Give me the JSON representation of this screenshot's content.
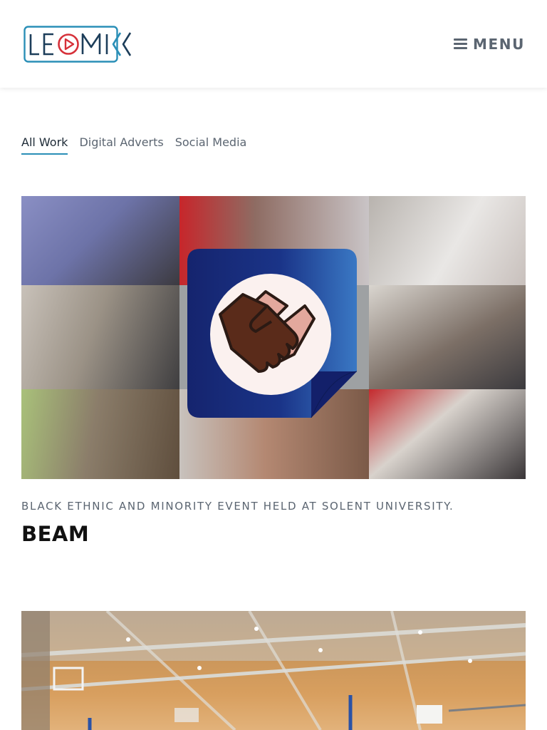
{
  "header": {
    "logo_text": "LEOMIK",
    "menu_label": "MENU",
    "colors": {
      "logo_blue": "#2a8fb7",
      "logo_red": "#d6313a",
      "logo_navy": "#1d3e5a",
      "menu_gray": "#5b6571"
    }
  },
  "filters": [
    {
      "label": "All Work",
      "active": true
    },
    {
      "label": "Digital Adverts",
      "active": false
    },
    {
      "label": "Social Media",
      "active": false
    }
  ],
  "projects": [
    {
      "tagline": "Black Ethnic and Minority event held at Solent University.",
      "title": "BEAM",
      "badge_icon": "handshake-icon",
      "colors": {
        "badge_navy": "#15246e",
        "badge_blue": "#2e65b4"
      }
    },
    {
      "tagline": "",
      "title": ""
    }
  ]
}
